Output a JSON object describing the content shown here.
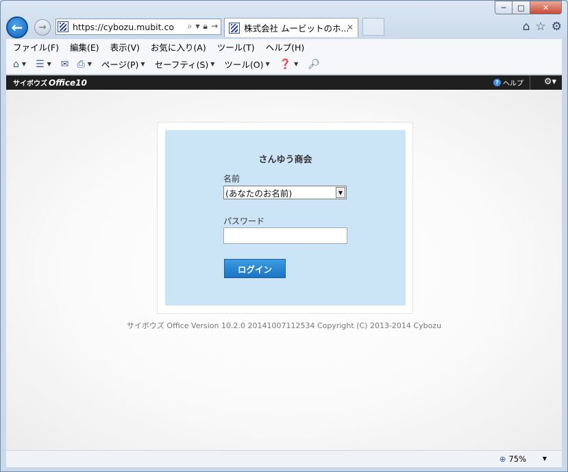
{
  "window": {
    "controls": {
      "minimize": "─",
      "maximize": "□",
      "close": "✕"
    }
  },
  "nav": {
    "back_icon": "arrow-left-icon",
    "forward_icon": "arrow-right-icon",
    "address": "https://cybozu.mubit.com",
    "tab_title": "株式会社 ムービットのホ...",
    "tab_close": "✕",
    "right_icons": [
      "home-icon",
      "star-icon",
      "gear-icon"
    ]
  },
  "menubar": {
    "items": [
      "ファイル(F)",
      "編集(E)",
      "表示(V)",
      "お気に入り(A)",
      "ツール(T)",
      "ヘルプ(H)"
    ]
  },
  "cmdbar": {
    "page_label": "ページ(P)",
    "safety_label": "セーフティ(S)",
    "tools_label": "ツール(O)"
  },
  "cybozu": {
    "logo_small": "サイボウズ",
    "logo_big": "Office10",
    "help_label": "ヘルプ"
  },
  "login": {
    "company": "さんゆう商会",
    "name_label": "名前",
    "name_value": "(あなたのお名前)",
    "password_label": "パスワード",
    "login_button": "ログイン"
  },
  "footer": {
    "copyright": "サイボウズ Office Version 10.2.0 20141007112534 Copyright (C) 2013-2014 Cybozu"
  },
  "status": {
    "zoom": "75%"
  },
  "colors": {
    "panel": "#cbe4f6",
    "button": "#1a74c4",
    "header": "#1f1f1f"
  }
}
